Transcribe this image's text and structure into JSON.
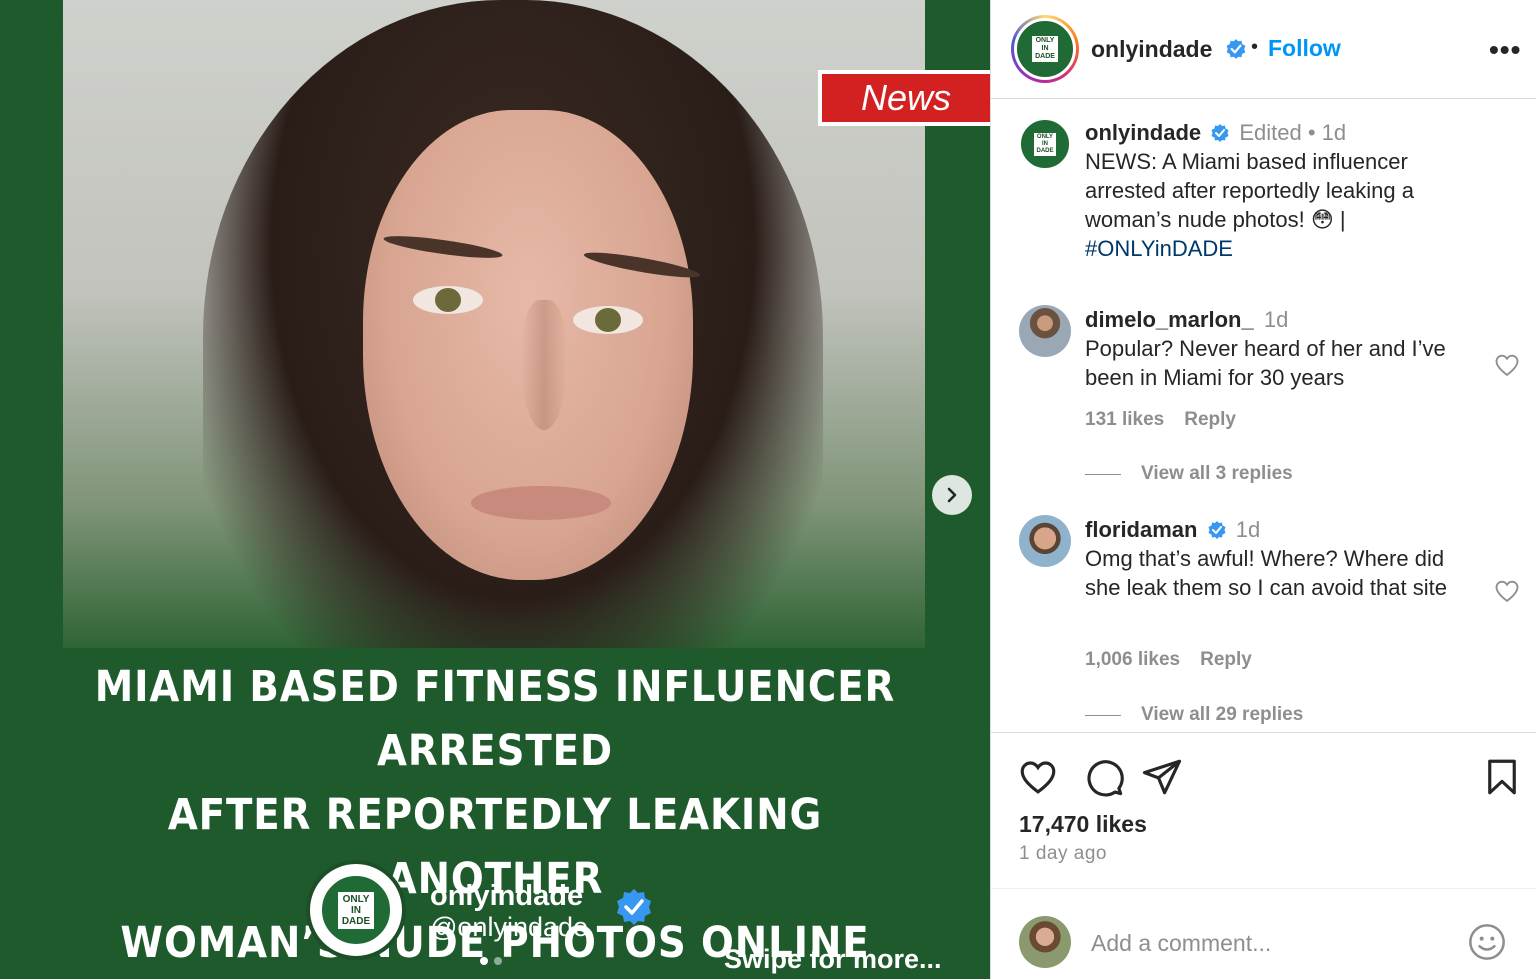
{
  "post_image": {
    "news_badge": "News",
    "headline_lines": [
      "Miami based fitness influencer arrested",
      "after reportedly leaking another",
      "woman’s nude photos online"
    ],
    "logo_text": [
      "ONLY",
      "IN",
      "DADE"
    ],
    "brand_name": "onlyindade",
    "brand_handle": "@onlyindade",
    "swipe_text": "Swipe for more...",
    "carousel_total": 2,
    "carousel_active": 1
  },
  "header": {
    "username": "onlyindade",
    "separator": "•",
    "follow_label": "Follow",
    "more_label": "•••"
  },
  "caption": {
    "username": "onlyindade",
    "meta": "Edited • 1d",
    "text": "NEWS: A Miami based influencer arrested after reportedly leaking a woman’s nude photos! 😳 |",
    "hashtag": "#ONLYinDADE"
  },
  "comments": [
    {
      "username": "dimelo_marlon_",
      "time": "1d",
      "text": "Popular? Never heard of her and I’ve been in Miami for 30 years",
      "likes": "131 likes",
      "reply_label": "Reply",
      "view_replies": "View all 3 replies"
    },
    {
      "username": "floridaman",
      "time": "1d",
      "text": "Omg that’s awful! Where? Where did she leak them so I can avoid that site",
      "likes": "1,006 likes",
      "reply_label": "Reply",
      "view_replies": "View all 29 replies"
    }
  ],
  "footer": {
    "likes": "17,470 likes",
    "time": "1 day ago",
    "comment_placeholder": "Add a comment..."
  },
  "icons": {
    "verified": "verified-badge-icon",
    "like": "heart-icon",
    "comment": "comment-bubble-icon",
    "share": "paper-plane-icon",
    "save": "bookmark-icon",
    "emoji": "smiley-icon",
    "next": "chevron-right-icon"
  },
  "colors": {
    "brand_green": "#1f5a2c",
    "news_red": "#d32020",
    "follow_blue": "#0095f6",
    "verified_blue": "#3897f0",
    "hashtag": "#00376b",
    "muted": "#8e8e8e"
  }
}
